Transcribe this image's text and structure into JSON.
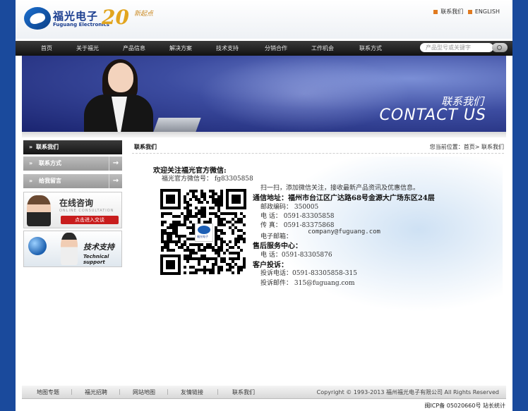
{
  "header": {
    "logo_cn": "福光电子",
    "logo_en": "Fuguang Electronics",
    "anniversary": "20",
    "anniversary_slogan": "新起点",
    "toplinks": [
      "联系我们",
      "ENGLISH"
    ]
  },
  "nav": {
    "items": [
      "首页",
      "关于福光",
      "产品信息",
      "解决方案",
      "技术支持",
      "分销合作",
      "工作机会",
      "联系方式"
    ],
    "search_placeholder": "产品型号或关键字"
  },
  "banner": {
    "title_cn": "联系我们",
    "title_en": "CONTACT US"
  },
  "sidebar": {
    "heading": "联系我们",
    "items": [
      "联系方式",
      "给我留言"
    ],
    "ad1": {
      "title": "在线咨询",
      "subtitle": "ONLINE CONSULTATION",
      "button": "点击进入交谈"
    },
    "ad2": {
      "title": "技术支持",
      "subtitle": "Technical support"
    }
  },
  "content": {
    "title": "联系我们",
    "breadcrumb": "您当前位置：首页> 联系我们",
    "wechat_heading": "欢迎关注福光官方微信:",
    "wechat_id": "福光官方微信号：  fg83305858",
    "scan_tip": "扫一扫，添加微信关注，接收最新产品资讯及优惠信息。",
    "address": "通信地址：福州市台江区广达路68号金源大广场东区24层",
    "postcode": "邮政编码：  350005",
    "phone": "电  话：  0591-83305858",
    "fax": "传  真：  0591-83375868",
    "email": "电子邮箱：",
    "email_value": "company@fuguang.com",
    "service_heading": "售后服务中心：",
    "service_phone": "电  话：0591-83305876",
    "complaint_heading": "客户投诉：",
    "complaint_phone": "投诉电话：0591-83305858-315",
    "complaint_email": "投诉邮件：  315@fuguang.com",
    "qr_caption": "福光电子"
  },
  "footer": {
    "links": [
      "地图专题",
      "福光招聘",
      "网站地图",
      "友情链接",
      "联系我们"
    ],
    "copyright": "Copyright © 1993-2013 福州福光电子有限公司 All Rights Reserved",
    "icp": "闽ICP备  05020660号  站长统计"
  },
  "colors": {
    "brand": "#1a3d8f",
    "page_bg": "#1a4a9c",
    "nav": "#1a1a1a",
    "accent": "#c81c1c"
  }
}
